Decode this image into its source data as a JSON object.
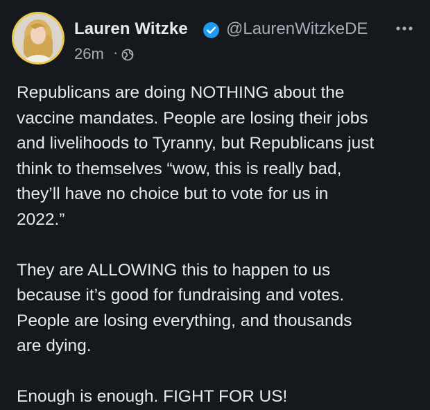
{
  "author": {
    "display_name": "Lauren Witzke",
    "handle": "@LaurenWitzkeDE",
    "verified": true
  },
  "meta": {
    "timestamp": "26m",
    "separator": "·",
    "audience_icon": "globe-icon"
  },
  "icons": {
    "verified": "verified-badge-icon",
    "more": "more-options-icon"
  },
  "colors": {
    "background": "#15181c",
    "text": "#e7e9ea",
    "secondary_text": "#a7aeb5",
    "verified_blue": "#1d9bf0",
    "avatar_ring": "#e9c84a"
  },
  "body": {
    "paragraphs": [
      "Republicans are doing NOTHING about the\nvaccine mandates. People are losing their jobs\nand livelihoods to Tyranny, but Republicans just\nthink to themselves “wow, this is really bad,\nthey’ll have no choice but to vote for us in\n2022.”",
      "They are ALLOWING this to happen to us\nbecause it’s good for fundraising and votes.\nPeople are losing everything, and thousands\nare dying.",
      "Enough is enough. FIGHT FOR US!"
    ]
  }
}
